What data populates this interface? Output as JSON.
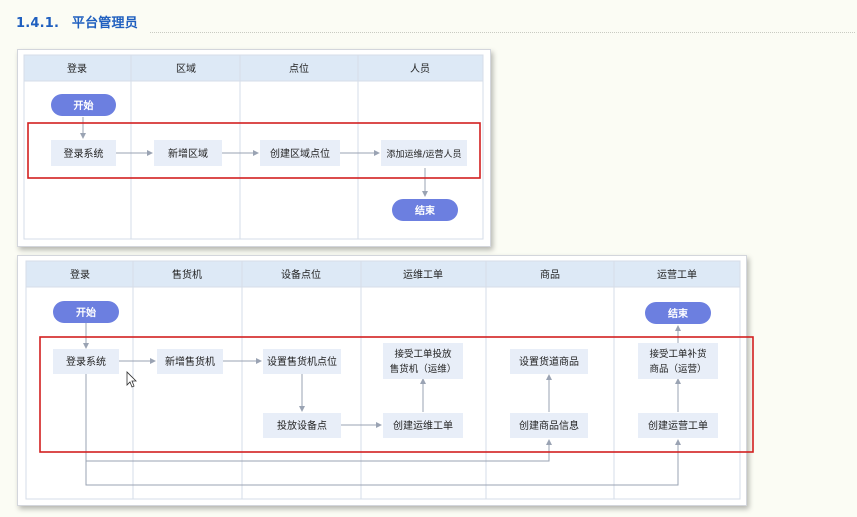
{
  "section": {
    "number": "1.4.1.",
    "title": "平台管理员"
  },
  "colors": {
    "heading": "#1f5fbf",
    "header_band": "#dde9f6",
    "process_box": "#e8eef8",
    "terminal": "#6c7fe0",
    "highlight": "#d22020",
    "connector": "#9aa3b3"
  },
  "diagram1": {
    "lanes": [
      "登录",
      "区域",
      "点位",
      "人员"
    ],
    "start": "开始",
    "end": "结束",
    "steps": [
      "登录系统",
      "新增区域",
      "创建区域点位",
      "添加运维/运营人员"
    ]
  },
  "diagram2": {
    "lanes": [
      "登录",
      "售货机",
      "设备点位",
      "运维工单",
      "商品",
      "运营工单"
    ],
    "start": "开始",
    "end": "结束",
    "steps": {
      "login": "登录系统",
      "add_vm": "新增售货机",
      "set_point": "设置售货机点位",
      "deploy": "投放设备点",
      "accept_ops_1": "接受工单投放",
      "accept_ops_2": "售货机（运维）",
      "create_ops": "创建运维工单",
      "set_channel": "设置货道商品",
      "create_goods": "创建商品信息",
      "accept_run_1": "接受工单补货",
      "accept_run_2": "商品（运营）",
      "create_run": "创建运营工单"
    }
  }
}
